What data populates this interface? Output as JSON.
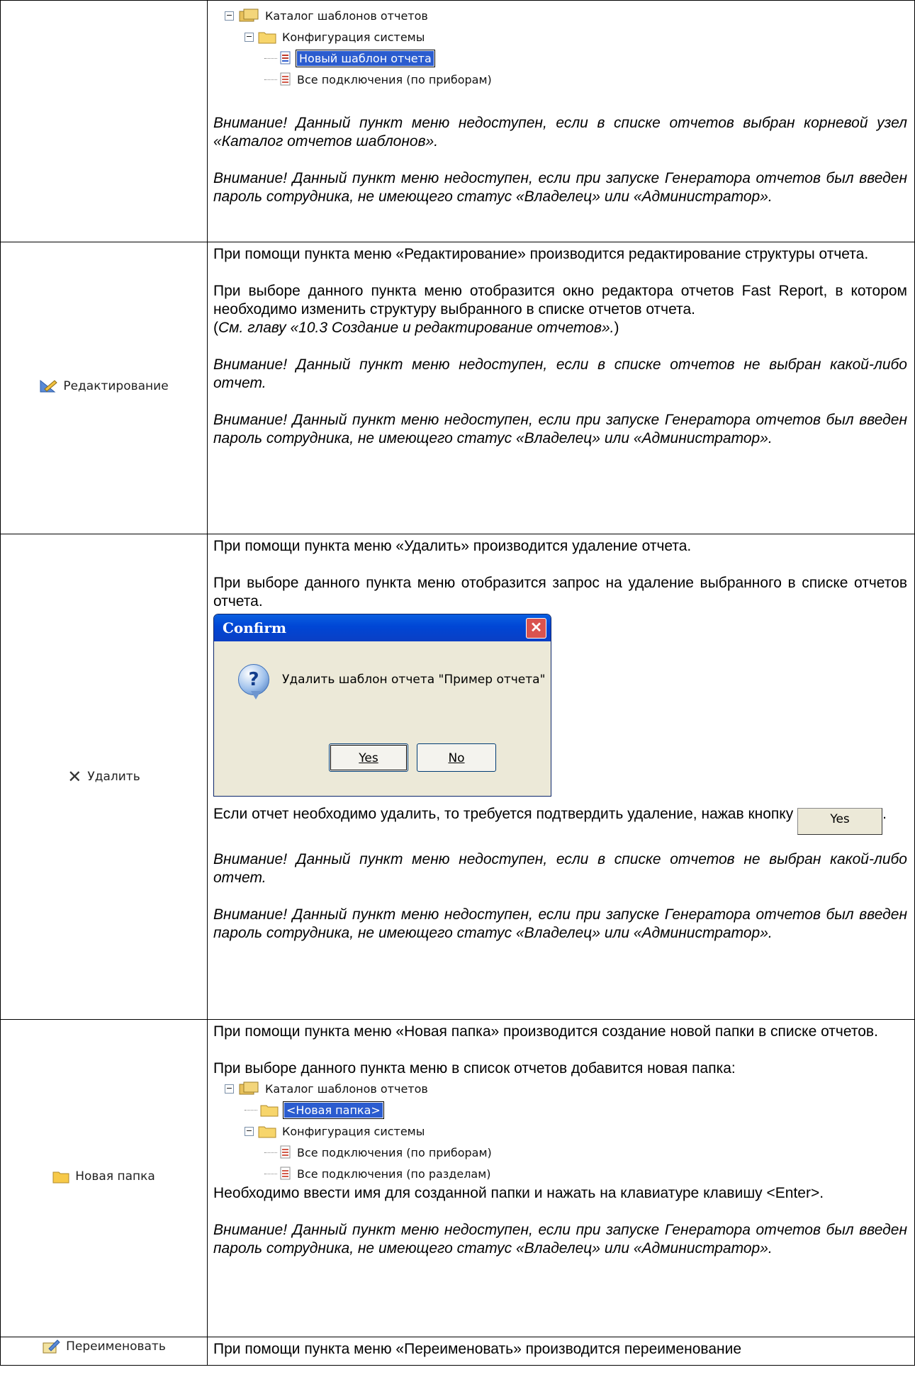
{
  "row1": {
    "tree": {
      "root": "Каталог шаблонов отчетов",
      "folder": "Конфигурация системы",
      "new_item": "Новый шаблон отчета",
      "item": "Все подключения (по приборам)"
    },
    "note1": "Внимание! Данный пункт меню недоступен, если в списке отчетов выбран корневой узел «Каталог отчетов шаблонов».",
    "note2": "Внимание! Данный пункт меню недоступен, если при запуске Генератора отчетов был введен пароль сотрудника, не имеющего статус «Владелец» или «Администратор»."
  },
  "row2": {
    "label": "Редактирование",
    "p1": "При помощи пункта меню «Редактирование» производится редактирование структуры отчета.",
    "p2": "При выборе данного пункта меню отобразится окно редактора отчетов Fast Report, в котором необходимо изменить структуру выбранного в списке отчетов отчета.",
    "p3_open": "(",
    "p3_ref": "См. главу «10.3 Создание и редактирование отчетов».",
    "p3_close": ")",
    "note1": "Внимание! Данный пункт меню недоступен, если в списке отчетов не выбран какой-либо отчет.",
    "note2": "Внимание! Данный пункт меню недоступен, если при запуске Генератора отчетов был введен пароль сотрудника, не имеющего статус «Владелец» или «Администратор»."
  },
  "row3": {
    "label": "Удалить",
    "p1": "При помощи пункта меню «Удалить» производится удаление отчета.",
    "p2": "При выборе данного пункта меню отобразится запрос на удаление выбранного в списке отчетов отчета.",
    "dialog": {
      "title": "Confirm",
      "message": "Удалить шаблон отчета \"Пример отчета\"",
      "yes": "Yes",
      "no": "No"
    },
    "p3": "Если отчет необходимо удалить, то требуется подтвердить удаление, нажав кнопку",
    "p3_btn": "Yes",
    "p3_end": ".",
    "note1": "Внимание! Данный пункт меню недоступен, если в списке отчетов не выбран какой-либо отчет.",
    "note2": "Внимание! Данный пункт меню недоступен, если при запуске Генератора отчетов был введен пароль сотрудника, не имеющего статус «Владелец» или «Администратор»."
  },
  "row4": {
    "label": "Новая папка",
    "p1": "При помощи пункта меню «Новая папка» производится создание новой папки в списке отчетов.",
    "p2": "При выборе данного пункта меню в список отчетов добавится новая папка:",
    "tree": {
      "root": "Каталог шаблонов отчетов",
      "new_folder": "<Новая папка>",
      "folder": "Конфигурация системы",
      "item1": "Все подключения (по приборам)",
      "item2": "Все подключения (по разделам)"
    },
    "p3": "Необходимо ввести имя для созданной папки и нажать на клавиатуре клавишу <Enter>.",
    "note2": "Внимание! Данный пункт меню недоступен, если при запуске Генератора отчетов был введен пароль сотрудника, не имеющего статус «Владелец» или «Администратор»."
  },
  "row5": {
    "label": "Переименовать",
    "p1": "При помощи пункта меню «Переименовать» производится переименование"
  }
}
